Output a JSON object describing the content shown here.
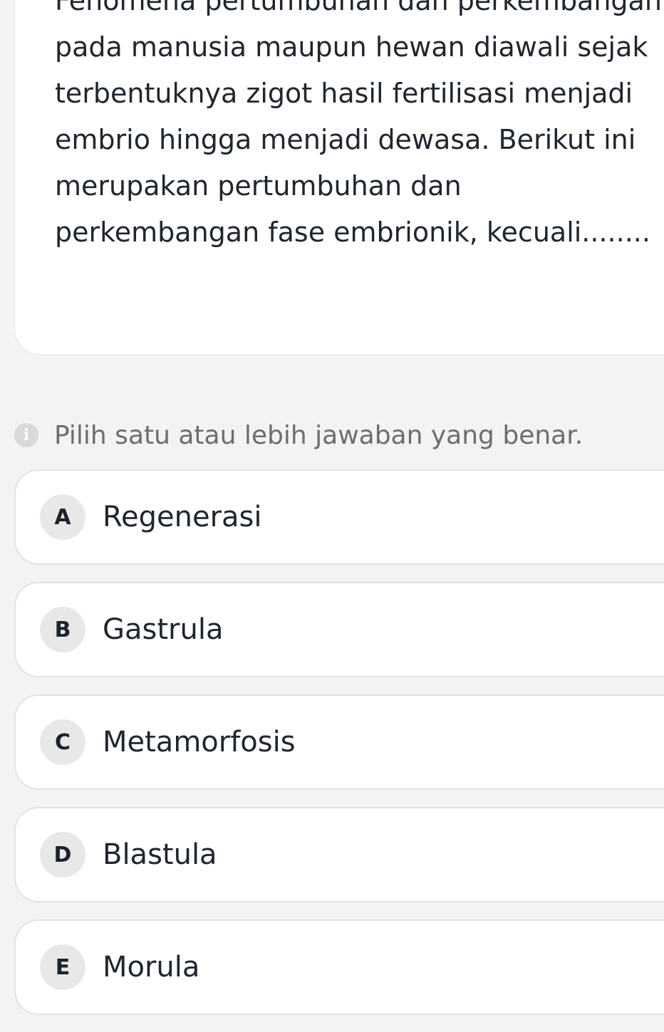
{
  "question": {
    "text": "Fenomena pertumbuhan dan perkembangan pada manusia maupun hewan diawali sejak terbentuknya zigot hasil fertilisasi menjadi embrio hingga menjadi dewasa. Berikut ini merupakan pertumbuhan dan perkembangan fase embrionik, kecuali........"
  },
  "instruction": {
    "icon": "info-icon",
    "icon_glyph": "i",
    "text": "Pilih satu atau lebih jawaban yang benar."
  },
  "options": [
    {
      "letter": "A",
      "label": "Regenerasi"
    },
    {
      "letter": "B",
      "label": "Gastrula"
    },
    {
      "letter": "C",
      "label": "Metamorfosis"
    },
    {
      "letter": "D",
      "label": "Blastula"
    },
    {
      "letter": "E",
      "label": "Morula"
    }
  ],
  "colors": {
    "background": "#f3f3f3",
    "card": "#ffffff",
    "letter_badge": "#e8e8e8",
    "text": "#20262e",
    "hint_text": "#6d6d6d"
  }
}
